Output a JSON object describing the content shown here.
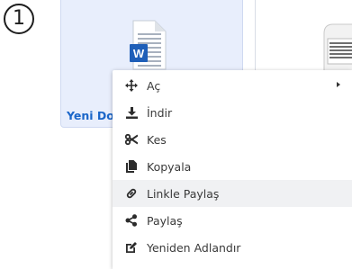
{
  "step": {
    "number": "1"
  },
  "file": {
    "name": "Yeni Dosya",
    "app_letter": "W"
  },
  "context_menu": {
    "items": [
      {
        "label": "Aç",
        "icon": "move-arrows-icon",
        "has_submenu": true
      },
      {
        "label": "İndir",
        "icon": "download-icon"
      },
      {
        "label": "Kes",
        "icon": "scissors-icon"
      },
      {
        "label": "Kopyala",
        "icon": "copy-icon"
      },
      {
        "label": "Linkle Paylaş",
        "icon": "link-icon",
        "highlighted": true
      },
      {
        "label": "Paylaş",
        "icon": "share-icon"
      },
      {
        "label": "Yeniden Adlandır",
        "icon": "rename-icon"
      }
    ]
  }
}
